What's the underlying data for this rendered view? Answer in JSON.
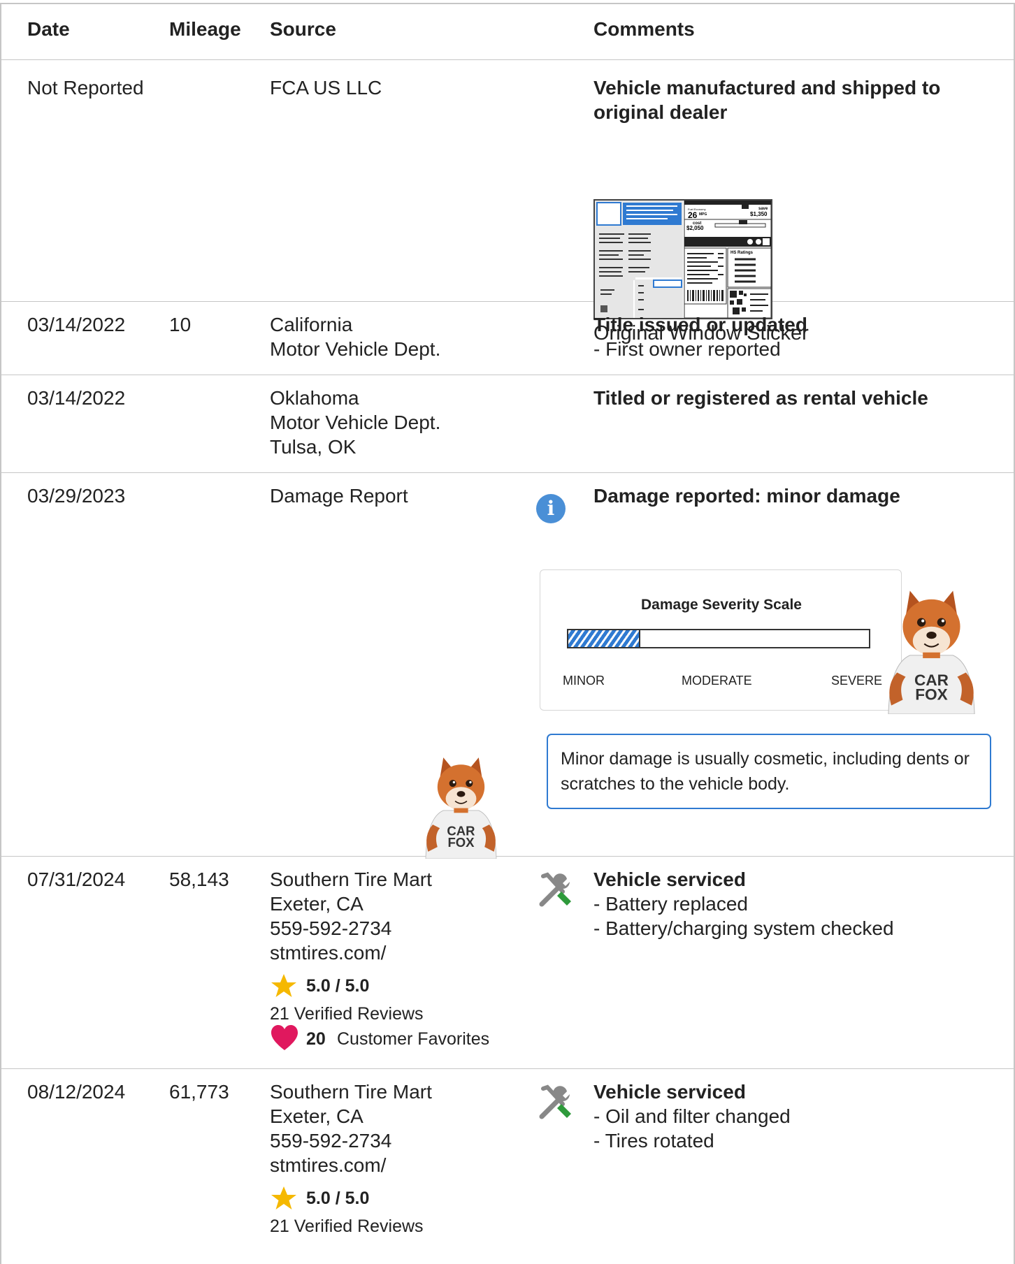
{
  "headers": {
    "date": "Date",
    "mileage": "Mileage",
    "source": "Source",
    "comments": "Comments"
  },
  "rows": [
    {
      "date": "Not Reported",
      "mileage": "",
      "source": "FCA US LLC",
      "comment_title": "Vehicle manufactured and shipped to original dealer",
      "sticker_caption": "Original Window Sticker",
      "sticker": {
        "mpg": "26",
        "mpg_unit": "MPG",
        "save_label": "save",
        "save_amount": "$1,350",
        "cost_label": "cost",
        "cost_amount": "$2,050",
        "ratings_label": "HS Ratings"
      }
    },
    {
      "date": "03/14/2022",
      "mileage": "10",
      "source": "California\nMotor Vehicle Dept.",
      "comment_title": "Title issued or updated",
      "details": [
        "- First owner reported"
      ]
    },
    {
      "date": "03/14/2022",
      "mileage": "",
      "source": "Oklahoma\nMotor Vehicle Dept.\nTulsa, OK",
      "comment_title": "Titled or registered as rental vehicle"
    },
    {
      "date": "03/29/2023",
      "mileage": "",
      "source": "Damage Report",
      "icon": "info-icon",
      "comment_title": "Damage reported: minor damage",
      "severity": {
        "title": "Damage Severity Scale",
        "labels": [
          "MINOR",
          "MODERATE",
          "SEVERE"
        ],
        "level": 0.24,
        "level_label": "MINOR"
      },
      "fox_shirt": "CAR\nFOX",
      "note": "Minor damage is usually cosmetic, including dents or scratches to the vehicle body."
    },
    {
      "date": "07/31/2024",
      "mileage": "58,143",
      "source": "Southern Tire Mart\nExeter, CA\n559-592-2734\nstmtires.com/",
      "icon": "wrench-screwdriver-icon",
      "comment_title": "Vehicle serviced",
      "details": [
        "- Battery replaced",
        "- Battery/charging system checked"
      ],
      "rating": "5.0 / 5.0",
      "reviews": "21 Verified Reviews",
      "favorites_count": "20",
      "favorites_label": "Customer Favorites"
    },
    {
      "date": "08/12/2024",
      "mileage": "61,773",
      "source": "Southern Tire Mart\nExeter, CA\n559-592-2734\nstmtires.com/",
      "icon": "wrench-screwdriver-icon",
      "comment_title": "Vehicle serviced",
      "details": [
        "- Oil and filter changed",
        "- Tires rotated"
      ],
      "rating": "5.0 / 5.0",
      "reviews": "21 Verified Reviews"
    }
  ],
  "colors": {
    "accent_blue": "#2f7ad1",
    "info_blue": "#4a8fd6",
    "star": "#f5b800",
    "heart": "#e0185e",
    "border": "#c6c6c6"
  }
}
